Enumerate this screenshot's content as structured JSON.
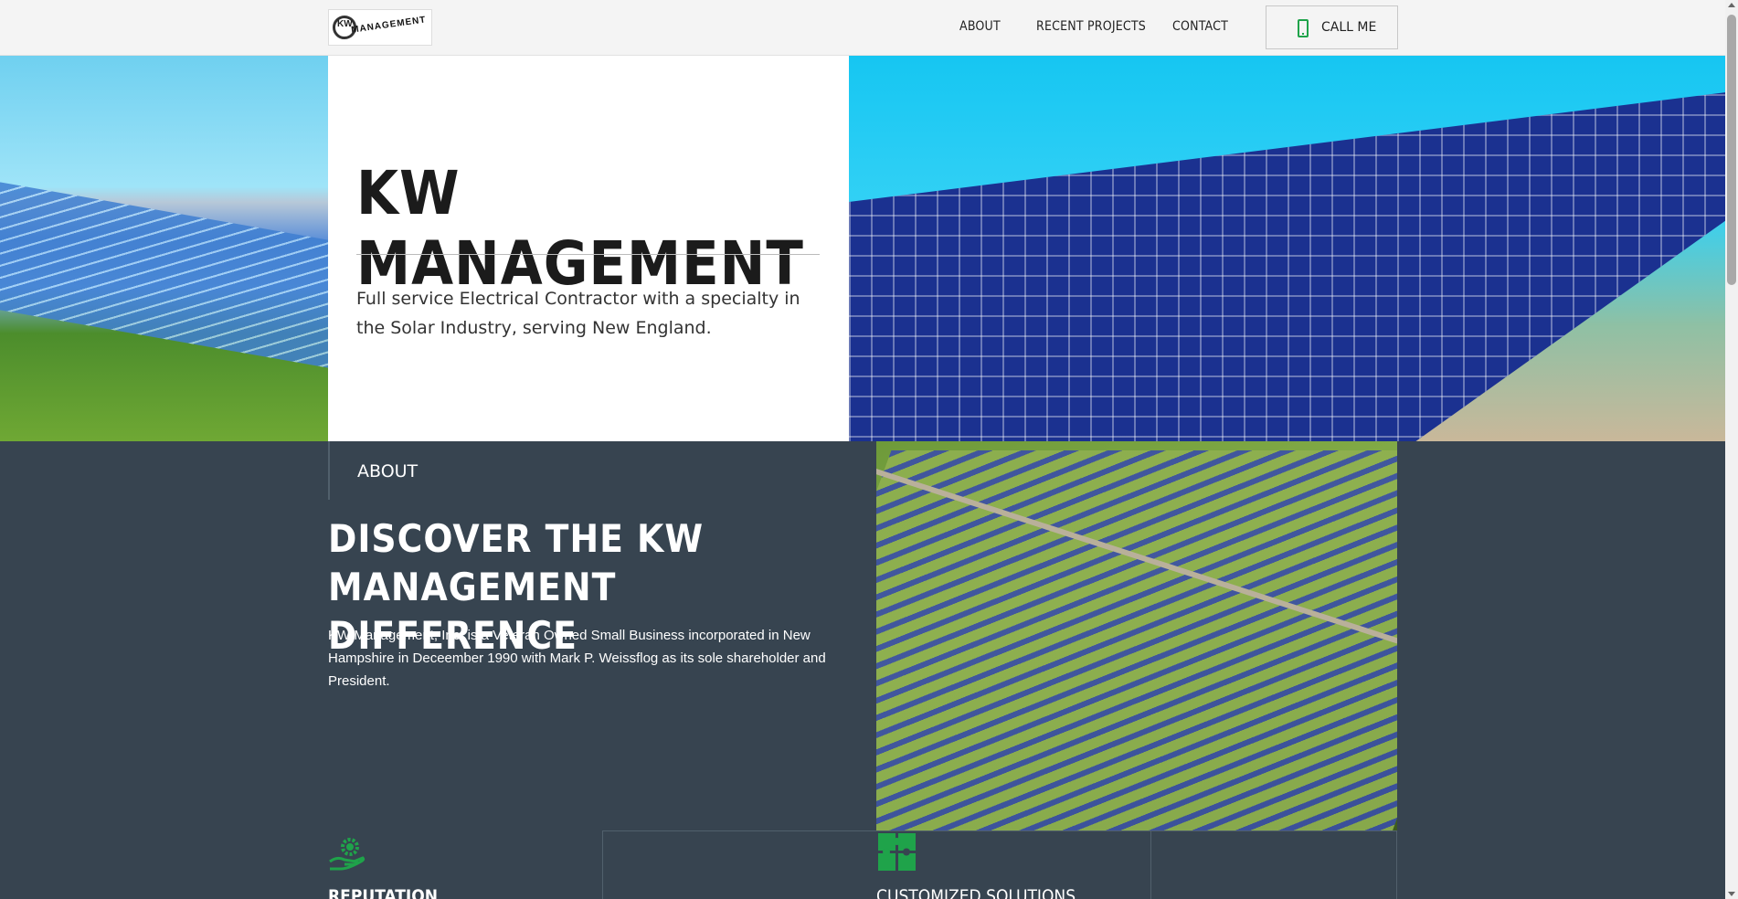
{
  "header": {
    "logo_initials": "KW",
    "logo_text": "MANAGEMENT",
    "nav": [
      "ABOUT",
      "RECENT PROJECTS",
      "CONTACT"
    ],
    "call_label": "CALL ME",
    "call_icon": "phone-icon"
  },
  "hero": {
    "title": "KW MANAGEMENT",
    "description": "Full service Electrical Contractor with a specialty in the Solar Industry, serving New England."
  },
  "about": {
    "label": "ABOUT",
    "heading": "DISCOVER THE KW MANAGEMENT DIFFERENCE",
    "text": " KW Management, Inc. is a Veteran Owned Small Business incorporated in New Hampshire in Deceember 1990 with Mark P. Weissflog as its sole shareholder and President."
  },
  "features": [
    {
      "icon": "gear-hand-icon",
      "title": "REPUTATION"
    },
    {
      "icon": "puzzle-icon",
      "title": "CUSTOMIZED SOLUTIONS"
    }
  ],
  "colors": {
    "accent": "#1fa34a",
    "dark_bg": "#374450",
    "header_bg": "#f4f4f4"
  }
}
